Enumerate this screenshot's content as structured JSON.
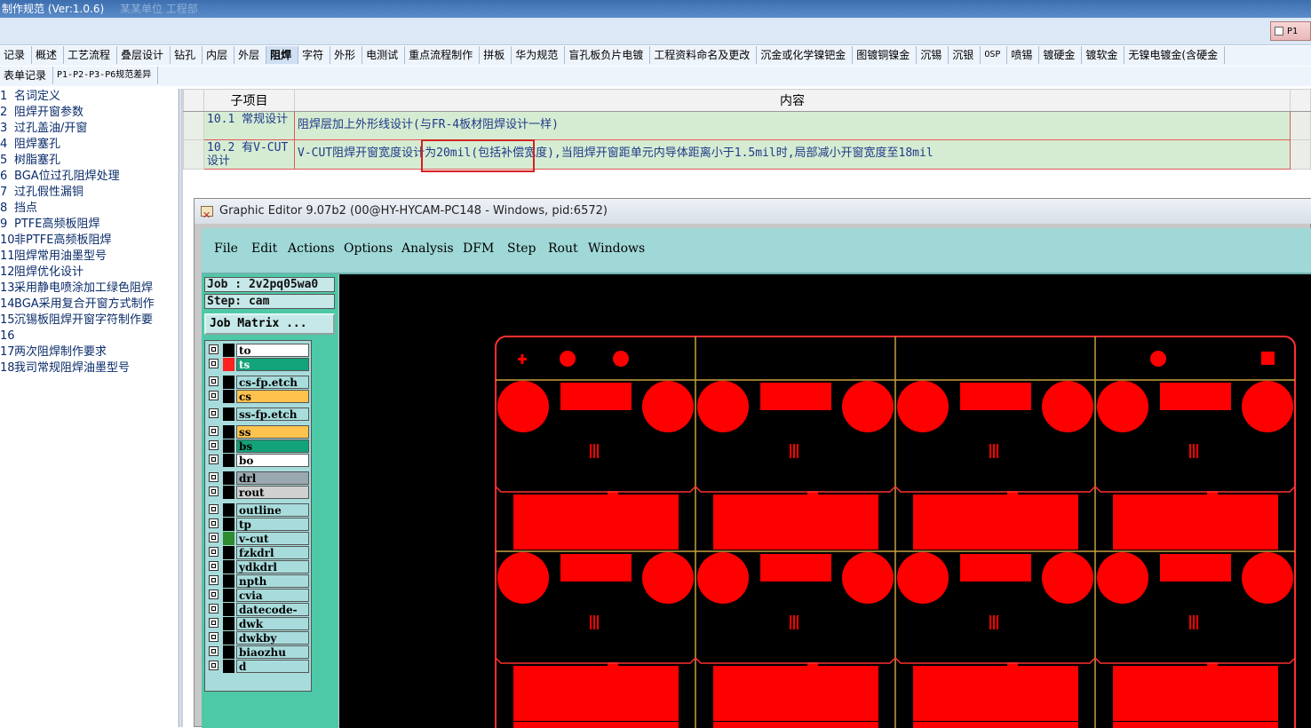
{
  "app": {
    "title": "制作规范 (Ver:1.0.6)",
    "title_blur": "某某单位 工程部"
  },
  "p1_button": {
    "label": "P1"
  },
  "tabs_row1": [
    {
      "label": "记录"
    },
    {
      "label": "概述"
    },
    {
      "label": "工艺流程"
    },
    {
      "label": "叠层设计"
    },
    {
      "label": "钻孔"
    },
    {
      "label": "内层"
    },
    {
      "label": "外层"
    },
    {
      "label": "阻焊",
      "active": true
    },
    {
      "label": "字符"
    },
    {
      "label": "外形"
    },
    {
      "label": "电测试"
    },
    {
      "label": "重点流程制作"
    },
    {
      "label": "拼板"
    },
    {
      "label": "华为规范"
    },
    {
      "label": "盲孔板负片电镀"
    },
    {
      "label": "工程资料命名及更改"
    },
    {
      "label": "沉金或化学镍钯金"
    },
    {
      "label": "图镀铜镍金"
    },
    {
      "label": "沉锡"
    },
    {
      "label": "沉银"
    },
    {
      "label": "OSP",
      "mono": true
    },
    {
      "label": "喷锡"
    },
    {
      "label": "镀硬金"
    },
    {
      "label": "镀软金"
    },
    {
      "label": "无镍电镀金(含硬金"
    }
  ],
  "tabs_row2": [
    {
      "label": "表单记录"
    },
    {
      "label": "P1-P2-P3-P6规范差异",
      "mono": true
    }
  ],
  "left_list": [
    {
      "n": "1",
      "label": "名词定义"
    },
    {
      "n": "2",
      "label": "阻焊开窗参数"
    },
    {
      "n": "3",
      "label": "过孔盖油/开窗"
    },
    {
      "n": "4",
      "label": "阻焊塞孔"
    },
    {
      "n": "5",
      "label": "树脂塞孔"
    },
    {
      "n": "6",
      "label": "BGA位过孔阻焊处理"
    },
    {
      "n": "7",
      "label": "过孔假性漏铜"
    },
    {
      "n": "8",
      "label": "挡点"
    },
    {
      "n": "9",
      "label": "PTFE高频板阻焊"
    },
    {
      "n": "10",
      "label": "非PTFE高频板阻焊"
    },
    {
      "n": "11",
      "label": "阻焊常用油墨型号"
    },
    {
      "n": "12",
      "label": "阻焊优化设计"
    },
    {
      "n": "13",
      "label": "采用静电喷涂加工绿色阻焊"
    },
    {
      "n": "14",
      "label": "BGA采用复合开窗方式制作"
    },
    {
      "n": "15",
      "label": "沉锡板阻焊开窗字符制作要"
    },
    {
      "n": "16",
      "label": ""
    },
    {
      "n": "17",
      "label": "两次阻焊制作要求"
    },
    {
      "n": "18",
      "label": "我司常规阻焊油墨型号"
    }
  ],
  "table": {
    "headers": {
      "sub": "子项目",
      "content": "内容"
    },
    "rows": [
      {
        "sub": "10.1 常规设计",
        "content": "阻焊层加上外形线设计(与FR-4板材阻焊设计一样)"
      },
      {
        "sub": "10.2 有V-CUT设计",
        "content": "V-CUT阻焊开窗宽度设计为20mil(包括补偿宽度),当阻焊开窗距单元内导体距离小于1.5mil时,局部减小开窗宽度至18mil"
      }
    ]
  },
  "editor": {
    "title": "Graphic Editor 9.07b2 (00@HY-HYCAM-PC148 - Windows, pid:6572)",
    "menu": [
      "File",
      "Edit",
      "Actions",
      "Options",
      "Analysis",
      "DFM",
      "Step",
      "Rout",
      "Windows"
    ],
    "job": "Job : 2v2pq05wa0",
    "step": "Step: cam",
    "job_matrix": "Job Matrix ...",
    "layers": [
      {
        "name": "to",
        "bg": "#ffffff",
        "mark": "#000000"
      },
      {
        "name": "ts",
        "bg": "#12a37a",
        "mark": "#ff2020",
        "active": true
      },
      {
        "name": "cs-fp.etch",
        "bg": "#a8dcdc",
        "mark": "#000000"
      },
      {
        "name": "cs",
        "bg": "#ffc34d",
        "mark": "#000000"
      },
      {
        "name": "ss-fp.etch",
        "bg": "#a8dcdc",
        "mark": "#000000"
      },
      {
        "name": "ss",
        "bg": "#ffc34d",
        "mark": "#000000"
      },
      {
        "name": "bs",
        "bg": "#12a37a",
        "mark": "#000000"
      },
      {
        "name": "bo",
        "bg": "#ffffff",
        "mark": "#000000"
      },
      {
        "name": "drl",
        "bg": "#9aa8b0",
        "mark": "#000000"
      },
      {
        "name": "rout",
        "bg": "#d0d0d0",
        "mark": "#000000"
      },
      {
        "name": "outline",
        "bg": "#a8dcdc",
        "mark": "#000000"
      },
      {
        "name": "tp",
        "bg": "#a8dcdc",
        "mark": "#000000"
      },
      {
        "name": "v-cut",
        "bg": "#a8dcdc",
        "mark": "#2e8b2e"
      },
      {
        "name": "fzkdrl",
        "bg": "#a8dcdc",
        "mark": "#000000"
      },
      {
        "name": "ydkdrl",
        "bg": "#a8dcdc",
        "mark": "#000000"
      },
      {
        "name": "npth",
        "bg": "#a8dcdc",
        "mark": "#000000"
      },
      {
        "name": "cvia",
        "bg": "#a8dcdc",
        "mark": "#000000"
      },
      {
        "name": "datecode-to",
        "bg": "#a8dcdc",
        "mark": "#000000"
      },
      {
        "name": "dwk",
        "bg": "#a8dcdc",
        "mark": "#000000"
      },
      {
        "name": "dwkby",
        "bg": "#a8dcdc",
        "mark": "#000000"
      },
      {
        "name": "biaozhu",
        "bg": "#a8dcdc",
        "mark": "#000000"
      },
      {
        "name": "d",
        "bg": "#a8dcdc",
        "mark": "#000000"
      }
    ]
  },
  "colors": {
    "accent_red": "#ff0000",
    "outline_gold": "#c8a040",
    "board_outline": "#ff3030"
  }
}
